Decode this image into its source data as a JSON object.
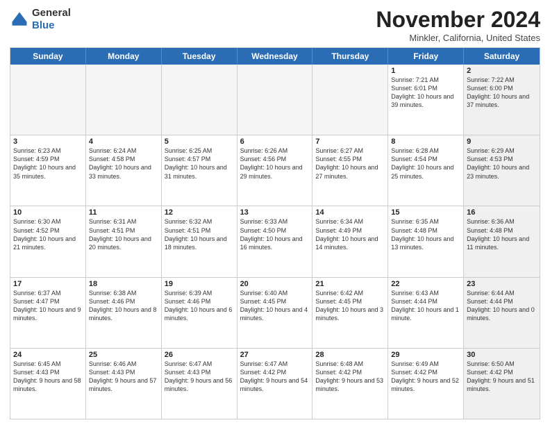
{
  "header": {
    "logo_general": "General",
    "logo_blue": "Blue",
    "month_title": "November 2024",
    "location": "Minkler, California, United States"
  },
  "days_of_week": [
    "Sunday",
    "Monday",
    "Tuesday",
    "Wednesday",
    "Thursday",
    "Friday",
    "Saturday"
  ],
  "weeks": [
    [
      {
        "day": "",
        "info": "",
        "empty": true
      },
      {
        "day": "",
        "info": "",
        "empty": true
      },
      {
        "day": "",
        "info": "",
        "empty": true
      },
      {
        "day": "",
        "info": "",
        "empty": true
      },
      {
        "day": "",
        "info": "",
        "empty": true
      },
      {
        "day": "1",
        "info": "Sunrise: 7:21 AM\nSunset: 6:01 PM\nDaylight: 10 hours and 39 minutes.",
        "empty": false,
        "shaded": false
      },
      {
        "day": "2",
        "info": "Sunrise: 7:22 AM\nSunset: 6:00 PM\nDaylight: 10 hours and 37 minutes.",
        "empty": false,
        "shaded": true
      }
    ],
    [
      {
        "day": "3",
        "info": "Sunrise: 6:23 AM\nSunset: 4:59 PM\nDaylight: 10 hours and 35 minutes.",
        "empty": false,
        "shaded": false
      },
      {
        "day": "4",
        "info": "Sunrise: 6:24 AM\nSunset: 4:58 PM\nDaylight: 10 hours and 33 minutes.",
        "empty": false,
        "shaded": false
      },
      {
        "day": "5",
        "info": "Sunrise: 6:25 AM\nSunset: 4:57 PM\nDaylight: 10 hours and 31 minutes.",
        "empty": false,
        "shaded": false
      },
      {
        "day": "6",
        "info": "Sunrise: 6:26 AM\nSunset: 4:56 PM\nDaylight: 10 hours and 29 minutes.",
        "empty": false,
        "shaded": false
      },
      {
        "day": "7",
        "info": "Sunrise: 6:27 AM\nSunset: 4:55 PM\nDaylight: 10 hours and 27 minutes.",
        "empty": false,
        "shaded": false
      },
      {
        "day": "8",
        "info": "Sunrise: 6:28 AM\nSunset: 4:54 PM\nDaylight: 10 hours and 25 minutes.",
        "empty": false,
        "shaded": false
      },
      {
        "day": "9",
        "info": "Sunrise: 6:29 AM\nSunset: 4:53 PM\nDaylight: 10 hours and 23 minutes.",
        "empty": false,
        "shaded": true
      }
    ],
    [
      {
        "day": "10",
        "info": "Sunrise: 6:30 AM\nSunset: 4:52 PM\nDaylight: 10 hours and 21 minutes.",
        "empty": false,
        "shaded": false
      },
      {
        "day": "11",
        "info": "Sunrise: 6:31 AM\nSunset: 4:51 PM\nDaylight: 10 hours and 20 minutes.",
        "empty": false,
        "shaded": false
      },
      {
        "day": "12",
        "info": "Sunrise: 6:32 AM\nSunset: 4:51 PM\nDaylight: 10 hours and 18 minutes.",
        "empty": false,
        "shaded": false
      },
      {
        "day": "13",
        "info": "Sunrise: 6:33 AM\nSunset: 4:50 PM\nDaylight: 10 hours and 16 minutes.",
        "empty": false,
        "shaded": false
      },
      {
        "day": "14",
        "info": "Sunrise: 6:34 AM\nSunset: 4:49 PM\nDaylight: 10 hours and 14 minutes.",
        "empty": false,
        "shaded": false
      },
      {
        "day": "15",
        "info": "Sunrise: 6:35 AM\nSunset: 4:48 PM\nDaylight: 10 hours and 13 minutes.",
        "empty": false,
        "shaded": false
      },
      {
        "day": "16",
        "info": "Sunrise: 6:36 AM\nSunset: 4:48 PM\nDaylight: 10 hours and 11 minutes.",
        "empty": false,
        "shaded": true
      }
    ],
    [
      {
        "day": "17",
        "info": "Sunrise: 6:37 AM\nSunset: 4:47 PM\nDaylight: 10 hours and 9 minutes.",
        "empty": false,
        "shaded": false
      },
      {
        "day": "18",
        "info": "Sunrise: 6:38 AM\nSunset: 4:46 PM\nDaylight: 10 hours and 8 minutes.",
        "empty": false,
        "shaded": false
      },
      {
        "day": "19",
        "info": "Sunrise: 6:39 AM\nSunset: 4:46 PM\nDaylight: 10 hours and 6 minutes.",
        "empty": false,
        "shaded": false
      },
      {
        "day": "20",
        "info": "Sunrise: 6:40 AM\nSunset: 4:45 PM\nDaylight: 10 hours and 4 minutes.",
        "empty": false,
        "shaded": false
      },
      {
        "day": "21",
        "info": "Sunrise: 6:42 AM\nSunset: 4:45 PM\nDaylight: 10 hours and 3 minutes.",
        "empty": false,
        "shaded": false
      },
      {
        "day": "22",
        "info": "Sunrise: 6:43 AM\nSunset: 4:44 PM\nDaylight: 10 hours and 1 minute.",
        "empty": false,
        "shaded": false
      },
      {
        "day": "23",
        "info": "Sunrise: 6:44 AM\nSunset: 4:44 PM\nDaylight: 10 hours and 0 minutes.",
        "empty": false,
        "shaded": true
      }
    ],
    [
      {
        "day": "24",
        "info": "Sunrise: 6:45 AM\nSunset: 4:43 PM\nDaylight: 9 hours and 58 minutes.",
        "empty": false,
        "shaded": false
      },
      {
        "day": "25",
        "info": "Sunrise: 6:46 AM\nSunset: 4:43 PM\nDaylight: 9 hours and 57 minutes.",
        "empty": false,
        "shaded": false
      },
      {
        "day": "26",
        "info": "Sunrise: 6:47 AM\nSunset: 4:43 PM\nDaylight: 9 hours and 56 minutes.",
        "empty": false,
        "shaded": false
      },
      {
        "day": "27",
        "info": "Sunrise: 6:47 AM\nSunset: 4:42 PM\nDaylight: 9 hours and 54 minutes.",
        "empty": false,
        "shaded": false
      },
      {
        "day": "28",
        "info": "Sunrise: 6:48 AM\nSunset: 4:42 PM\nDaylight: 9 hours and 53 minutes.",
        "empty": false,
        "shaded": false
      },
      {
        "day": "29",
        "info": "Sunrise: 6:49 AM\nSunset: 4:42 PM\nDaylight: 9 hours and 52 minutes.",
        "empty": false,
        "shaded": false
      },
      {
        "day": "30",
        "info": "Sunrise: 6:50 AM\nSunset: 4:42 PM\nDaylight: 9 hours and 51 minutes.",
        "empty": false,
        "shaded": true
      }
    ]
  ]
}
